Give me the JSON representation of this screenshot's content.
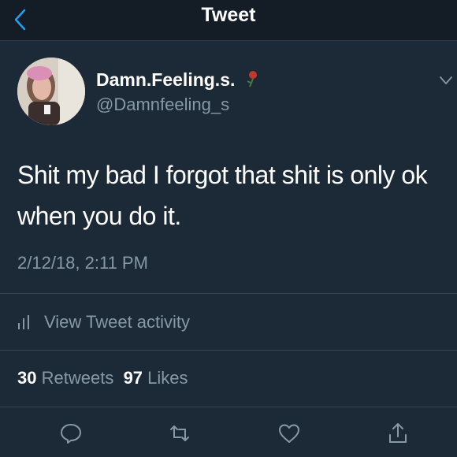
{
  "header": {
    "title": "Tweet"
  },
  "author": {
    "display_name": "Damn.Feeling.s.",
    "handle": "@Damnfeeling_s"
  },
  "tweet": {
    "text": "Shit my bad I forgot that shit is only ok when you do it.",
    "timestamp": "2/12/18, 2:11 PM"
  },
  "activity": {
    "label": "View Tweet activity"
  },
  "stats": {
    "retweets_count": "30",
    "retweets_label": "Retweets",
    "likes_count": "97",
    "likes_label": "Likes"
  },
  "icons": [
    "back-chevron-icon",
    "rose-emoji-icon",
    "caret-down-icon",
    "bar-chart-icon",
    "reply-icon",
    "retweet-icon",
    "like-icon",
    "share-icon"
  ],
  "colors": {
    "background": "#141d26",
    "secondary_text": "#8899a6",
    "accent": "#1da1f2",
    "rose": "#c0392b"
  }
}
